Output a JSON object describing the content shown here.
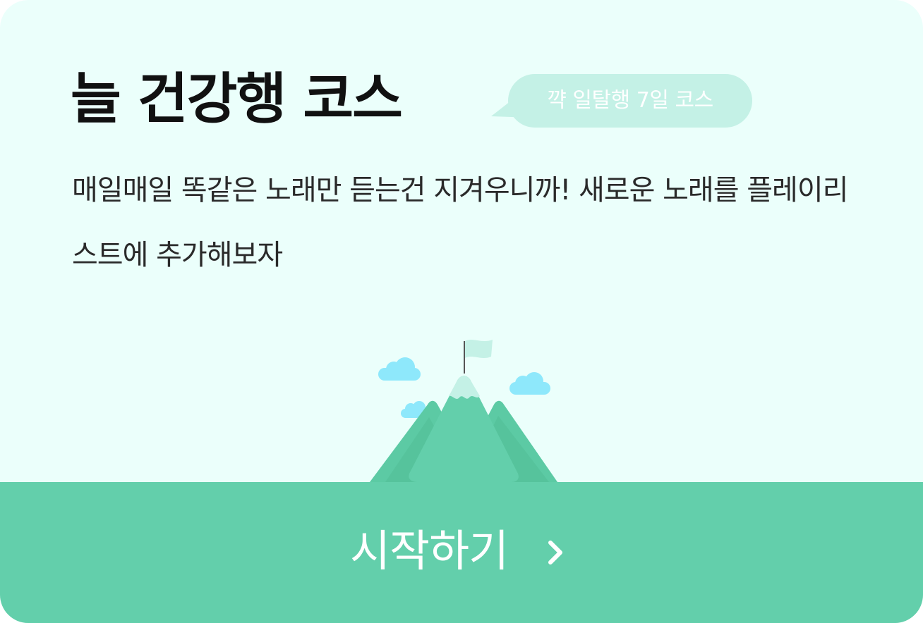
{
  "course": {
    "title": "늘 건강행 코스",
    "badge": "꺅 일탈행  7일 코스",
    "description": "매일매일 똑같은 노래만 듣는건 지겨우니까! 새로운 노래를 플레이리스트에 추가해보자"
  },
  "button": {
    "label": "시작하기"
  },
  "icons": {
    "illustration": "mountain-with-flag-illustration",
    "chevron": "chevron-right-icon"
  },
  "colors": {
    "background": "#ebfffb",
    "accent": "#63cfab",
    "badge": "#c4f1e6",
    "cloud": "#8ee8fb"
  }
}
